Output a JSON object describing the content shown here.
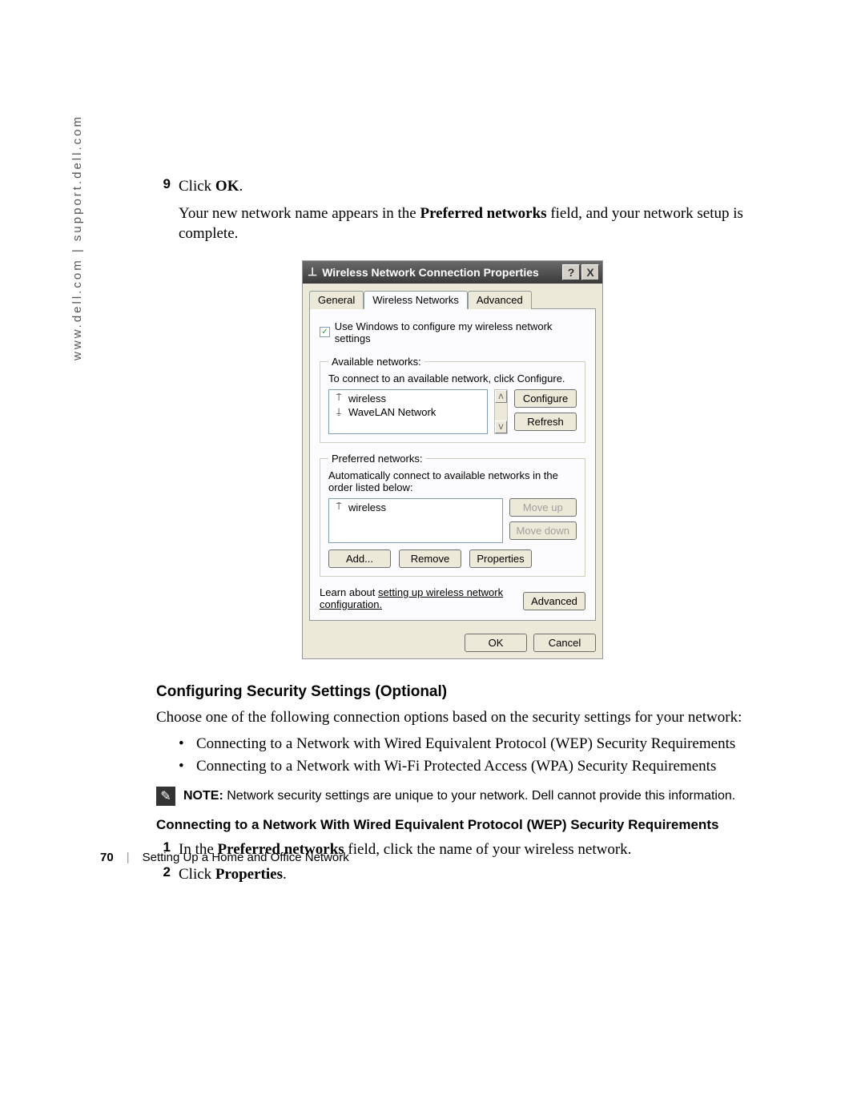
{
  "sidebar": {
    "url": "www.dell.com | support.dell.com"
  },
  "step9": {
    "num": "9",
    "prefix": "Click ",
    "bold": "OK",
    "suffix": "."
  },
  "para1": {
    "p1": "Your new network name appears in the ",
    "bold": "Preferred networks",
    "p2": " field, and your network setup is complete."
  },
  "dialog": {
    "title": "Wireless Network Connection Properties",
    "help": "?",
    "close": "X",
    "tabs": {
      "general": "General",
      "wireless": "Wireless Networks",
      "advanced": "Advanced"
    },
    "checkbox": "Use Windows to configure my wireless network settings",
    "available": {
      "legend": "Available networks:",
      "desc": "To connect to an available network, click Configure.",
      "items": [
        "wireless",
        "WaveLAN Network"
      ],
      "configure": "Configure",
      "refresh": "Refresh"
    },
    "preferred": {
      "legend": "Preferred networks:",
      "desc": "Automatically connect to available networks in the order listed below:",
      "items": [
        "wireless"
      ],
      "moveup": "Move up",
      "movedown": "Move down",
      "add": "Add...",
      "remove": "Remove",
      "properties": "Properties"
    },
    "learn": {
      "p1": "Learn about ",
      "link": "setting up wireless network configuration.",
      "advanced": "Advanced"
    },
    "ok": "OK",
    "cancel": "Cancel"
  },
  "section": {
    "h2": "Configuring Security Settings (Optional)",
    "intro": "Choose one of the following connection options based on the security settings for your network:",
    "bullets": [
      "Connecting to a Network with Wired Equivalent Protocol (WEP) Security Requirements",
      "Connecting to a Network with Wi-Fi Protected Access (WPA) Security Requirements"
    ],
    "note_label": "NOTE:",
    "note_text": " Network security settings are unique to your network. Dell cannot provide this information.",
    "h3": "Connecting to a Network With Wired Equivalent Protocol (WEP) Security Requirements",
    "step1": {
      "num": "1",
      "p1": "In the ",
      "bold": "Preferred networks",
      "p2": " field, click the name of your wireless network."
    },
    "step2": {
      "num": "2",
      "p1": "Click ",
      "bold": "Properties",
      "p2": "."
    }
  },
  "footer": {
    "page": "70",
    "chapter": "Setting Up a Home and Office Network"
  }
}
